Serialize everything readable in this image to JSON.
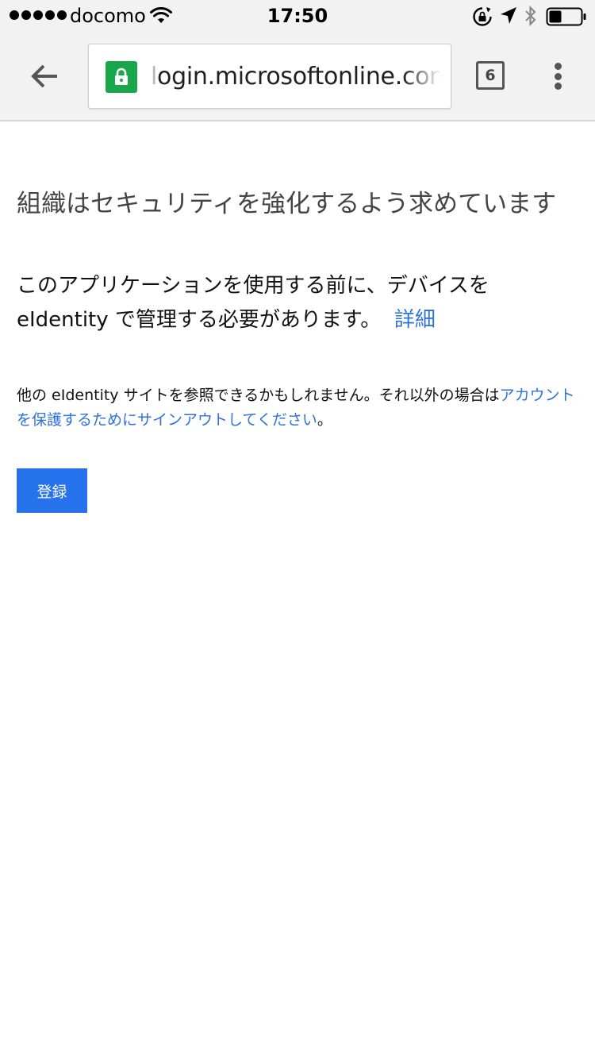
{
  "status_bar": {
    "carrier": "docomo",
    "time": "17:50",
    "signal_bars": 5,
    "battery_level": 0.35,
    "icons": [
      "signal-dots-icon",
      "wifi-icon",
      "rotation-lock-icon",
      "location-arrow-icon",
      "bluetooth-icon",
      "battery-icon"
    ]
  },
  "toolbar": {
    "url_faded": "l",
    "url_main": "ogin.microsoftonline.com",
    "tab_count": "6",
    "icons": [
      "back-arrow-icon",
      "lock-icon",
      "tab-switcher-icon",
      "overflow-menu-icon"
    ]
  },
  "page": {
    "title": "組織はセキュリティを強化するよう求めています",
    "message": "このアプリケーションを使用する前に、デバイスを eIdentity で管理する必要があります。",
    "details_link": "詳細",
    "sub_message_text": "他の eIdentity サイトを参照できるかもしれません。それ以外の場合は",
    "sub_message_link": "アカウントを保護するためにサインアウトしてください",
    "sub_message_end": "。",
    "enroll_button": "登録"
  },
  "colors": {
    "link": "#2f73d9",
    "button": "#2672ec",
    "lock_badge": "#1aa64b",
    "toolbar_bg": "#f2f2f2"
  }
}
